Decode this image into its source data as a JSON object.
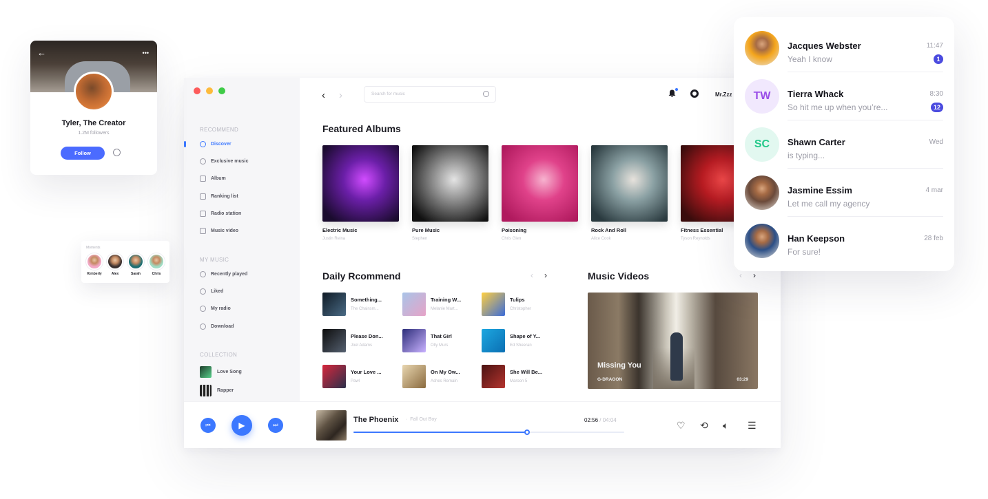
{
  "window": {
    "dot_colors": [
      "#fd5b5b",
      "#fdbb3c",
      "#3fcb47"
    ]
  },
  "sidebar": {
    "recommend_title": "RECOMMEND",
    "recommend_items": [
      {
        "label": "Discover",
        "icon": "compass-icon"
      },
      {
        "label": "Exclusive music",
        "icon": "disc-icon"
      },
      {
        "label": "Album",
        "icon": "album-icon"
      },
      {
        "label": "Ranking list",
        "icon": "chart-icon"
      },
      {
        "label": "Radio station",
        "icon": "radio-icon"
      },
      {
        "label": "Music video",
        "icon": "video-icon"
      }
    ],
    "mymusic_title": "MY MUSIC",
    "mymusic_items": [
      {
        "label": "Recently played",
        "icon": "clock-icon"
      },
      {
        "label": "Liked",
        "icon": "heart-icon"
      },
      {
        "label": "My radio",
        "icon": "radio-icon"
      },
      {
        "label": "Download",
        "icon": "download-icon"
      }
    ],
    "collection_title": "COLLECTION",
    "collection_items": [
      {
        "label": "Love Song"
      },
      {
        "label": "Rapper"
      }
    ]
  },
  "topbar": {
    "search_placeholder": "Search for music",
    "user": "Mr.Zzz"
  },
  "featured": {
    "title": "Featured Albums",
    "albums": [
      {
        "title": "Electric Music",
        "artist": "Justin Reina",
        "colors": [
          "#1a0b2e",
          "#6b1fa8",
          "#d14cff"
        ]
      },
      {
        "title": "Pure Music",
        "artist": "Stephen",
        "colors": [
          "#111111",
          "#8e8e8e",
          "#e4e4e4"
        ]
      },
      {
        "title": "Poisoning",
        "artist": "Chris Glen",
        "colors": [
          "#b01a5e",
          "#e0428a",
          "#f7b3cf"
        ]
      },
      {
        "title": "Rock And Roll",
        "artist": "Alice Cook",
        "colors": [
          "#2a3a3f",
          "#8aa0a3",
          "#e7e2dc"
        ]
      },
      {
        "title": "Fitness Essential",
        "artist": "Tyson Reynolds",
        "colors": [
          "#3a0c0c",
          "#b81c22",
          "#f04848"
        ]
      }
    ]
  },
  "daily": {
    "title": "Daily Rcommend",
    "songs": [
      {
        "title": "Something...",
        "artist": "The Chainsm...",
        "colors": [
          "#0f1a25",
          "#4a6b85"
        ]
      },
      {
        "title": "Training W...",
        "artist": "Melanie Mart...",
        "colors": [
          "#a9c4e8",
          "#e6a3c7"
        ]
      },
      {
        "title": "Tulips",
        "artist": "Christopher",
        "colors": [
          "#ffcf40",
          "#3b6cd9"
        ]
      },
      {
        "title": "Please Don...",
        "artist": "Joel Adams",
        "colors": [
          "#0d0d0d",
          "#556070"
        ]
      },
      {
        "title": "That Girl",
        "artist": "Olly Murs",
        "colors": [
          "#2d2e7a",
          "#c9b2ff"
        ]
      },
      {
        "title": "Shape of Y...",
        "artist": "Ed Sheeran",
        "colors": [
          "#1da7e0",
          "#0b6fb3"
        ]
      },
      {
        "title": "Your Love ...",
        "artist": "Pawl",
        "colors": [
          "#d7273c",
          "#2a2f4a"
        ]
      },
      {
        "title": "On My Ow...",
        "artist": "Ashes Remain",
        "colors": [
          "#e8d6b0",
          "#8a6a3e"
        ]
      },
      {
        "title": "She Will Be...",
        "artist": "Maroon 5",
        "colors": [
          "#4a1212",
          "#b5342e"
        ]
      }
    ]
  },
  "videos": {
    "title": "Music Videos",
    "video_title": "Missing You",
    "video_artist": "G-DRAGON",
    "duration": "03:29"
  },
  "player": {
    "title": "The Phoenix",
    "separator": "·",
    "artist": "Fall Out Boy",
    "current": "02:56",
    "total": "/ 04:04",
    "progress": 0.64
  },
  "profile": {
    "name": "Tyler, The Creator",
    "followers": "1.2M followers",
    "follow_label": "Follow",
    "back_glyph": "←",
    "more_glyph": "•••"
  },
  "moments": {
    "label": "Moments",
    "people": [
      {
        "name": "Kimberly",
        "color": "#f2a8c6"
      },
      {
        "name": "Alex",
        "color": "#3a3030"
      },
      {
        "name": "Sarah",
        "color": "#1e6f73"
      },
      {
        "name": "Chris",
        "color": "#9fdcc4"
      }
    ]
  },
  "messages": [
    {
      "name": "Jacques Webster",
      "preview": "Yeah I know",
      "time": "11:47",
      "badge": "1",
      "avatar_type": "photo",
      "avatar_bg": "#f4a51c",
      "initials": ""
    },
    {
      "name": "Tierra Whack",
      "preview": "So hit me up when you’re...",
      "time": "8:30",
      "badge": "12",
      "avatar_type": "initials",
      "avatar_bg": "#f1e8fd",
      "avatar_fg": "#9a4ee8",
      "initials": "TW"
    },
    {
      "name": "Shawn Carter",
      "preview": "is typing...",
      "time": "Wed",
      "badge": "",
      "avatar_type": "initials",
      "avatar_bg": "#e2f8f0",
      "avatar_fg": "#23c98a",
      "initials": "SC"
    },
    {
      "name": "Jasmine Essim",
      "preview": "Let me call my agency",
      "time": "4 mar",
      "badge": "",
      "avatar_type": "photo",
      "avatar_bg": "#6b4a3a",
      "initials": ""
    },
    {
      "name": "Han Keepson",
      "preview": "For sure!",
      "time": "28 feb",
      "badge": "",
      "avatar_type": "photo",
      "avatar_bg": "#2c4f86",
      "initials": ""
    }
  ]
}
